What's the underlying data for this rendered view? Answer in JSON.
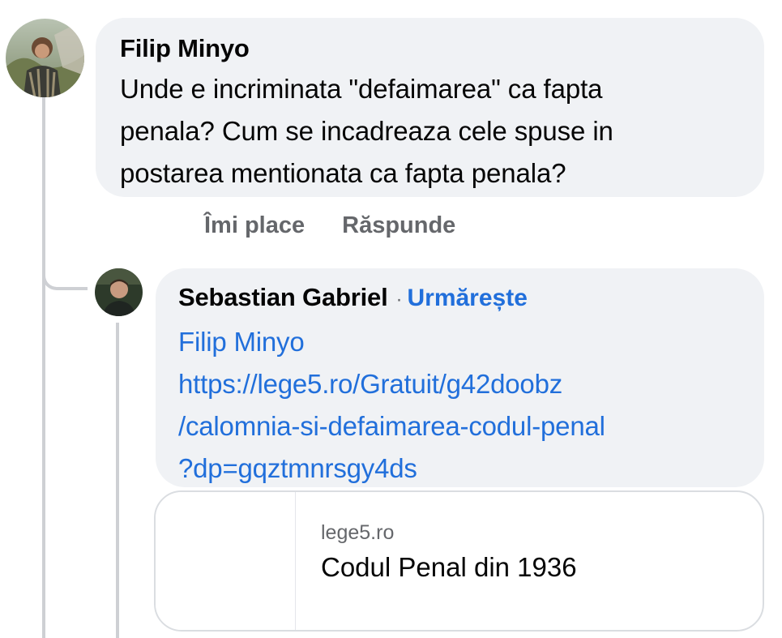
{
  "comment": {
    "author": "Filip Minyo",
    "text_lines": [
      "Unde e incriminata \"defaimarea\" ca fapta",
      "penala? Cum se incadreaza cele spuse in",
      "postarea mentionata ca fapta penala?"
    ],
    "actions": {
      "like": "Îmi place",
      "reply": "Răspunde"
    }
  },
  "reply": {
    "author": "Sebastian Gabriel",
    "separator": "·",
    "follow_label": "Urmărește",
    "mention": "Filip Minyo",
    "link_lines": [
      "https://lege5.ro/Gratuit/g42doobz",
      "/calomnia-si-defaimarea-codul-penal",
      "?dp=gqztmnrsgy4ds"
    ],
    "preview": {
      "domain": "lege5.ro",
      "title": "Codul Penal din 1936"
    }
  },
  "colors": {
    "bubble_bg": "#f0f2f5",
    "link": "#216fdb",
    "secondary_text": "#65676b",
    "thread_line": "#ced0d4"
  },
  "icons": {
    "comment_avatar": "user-avatar-photo",
    "reply_avatar": "user-avatar-photo"
  }
}
